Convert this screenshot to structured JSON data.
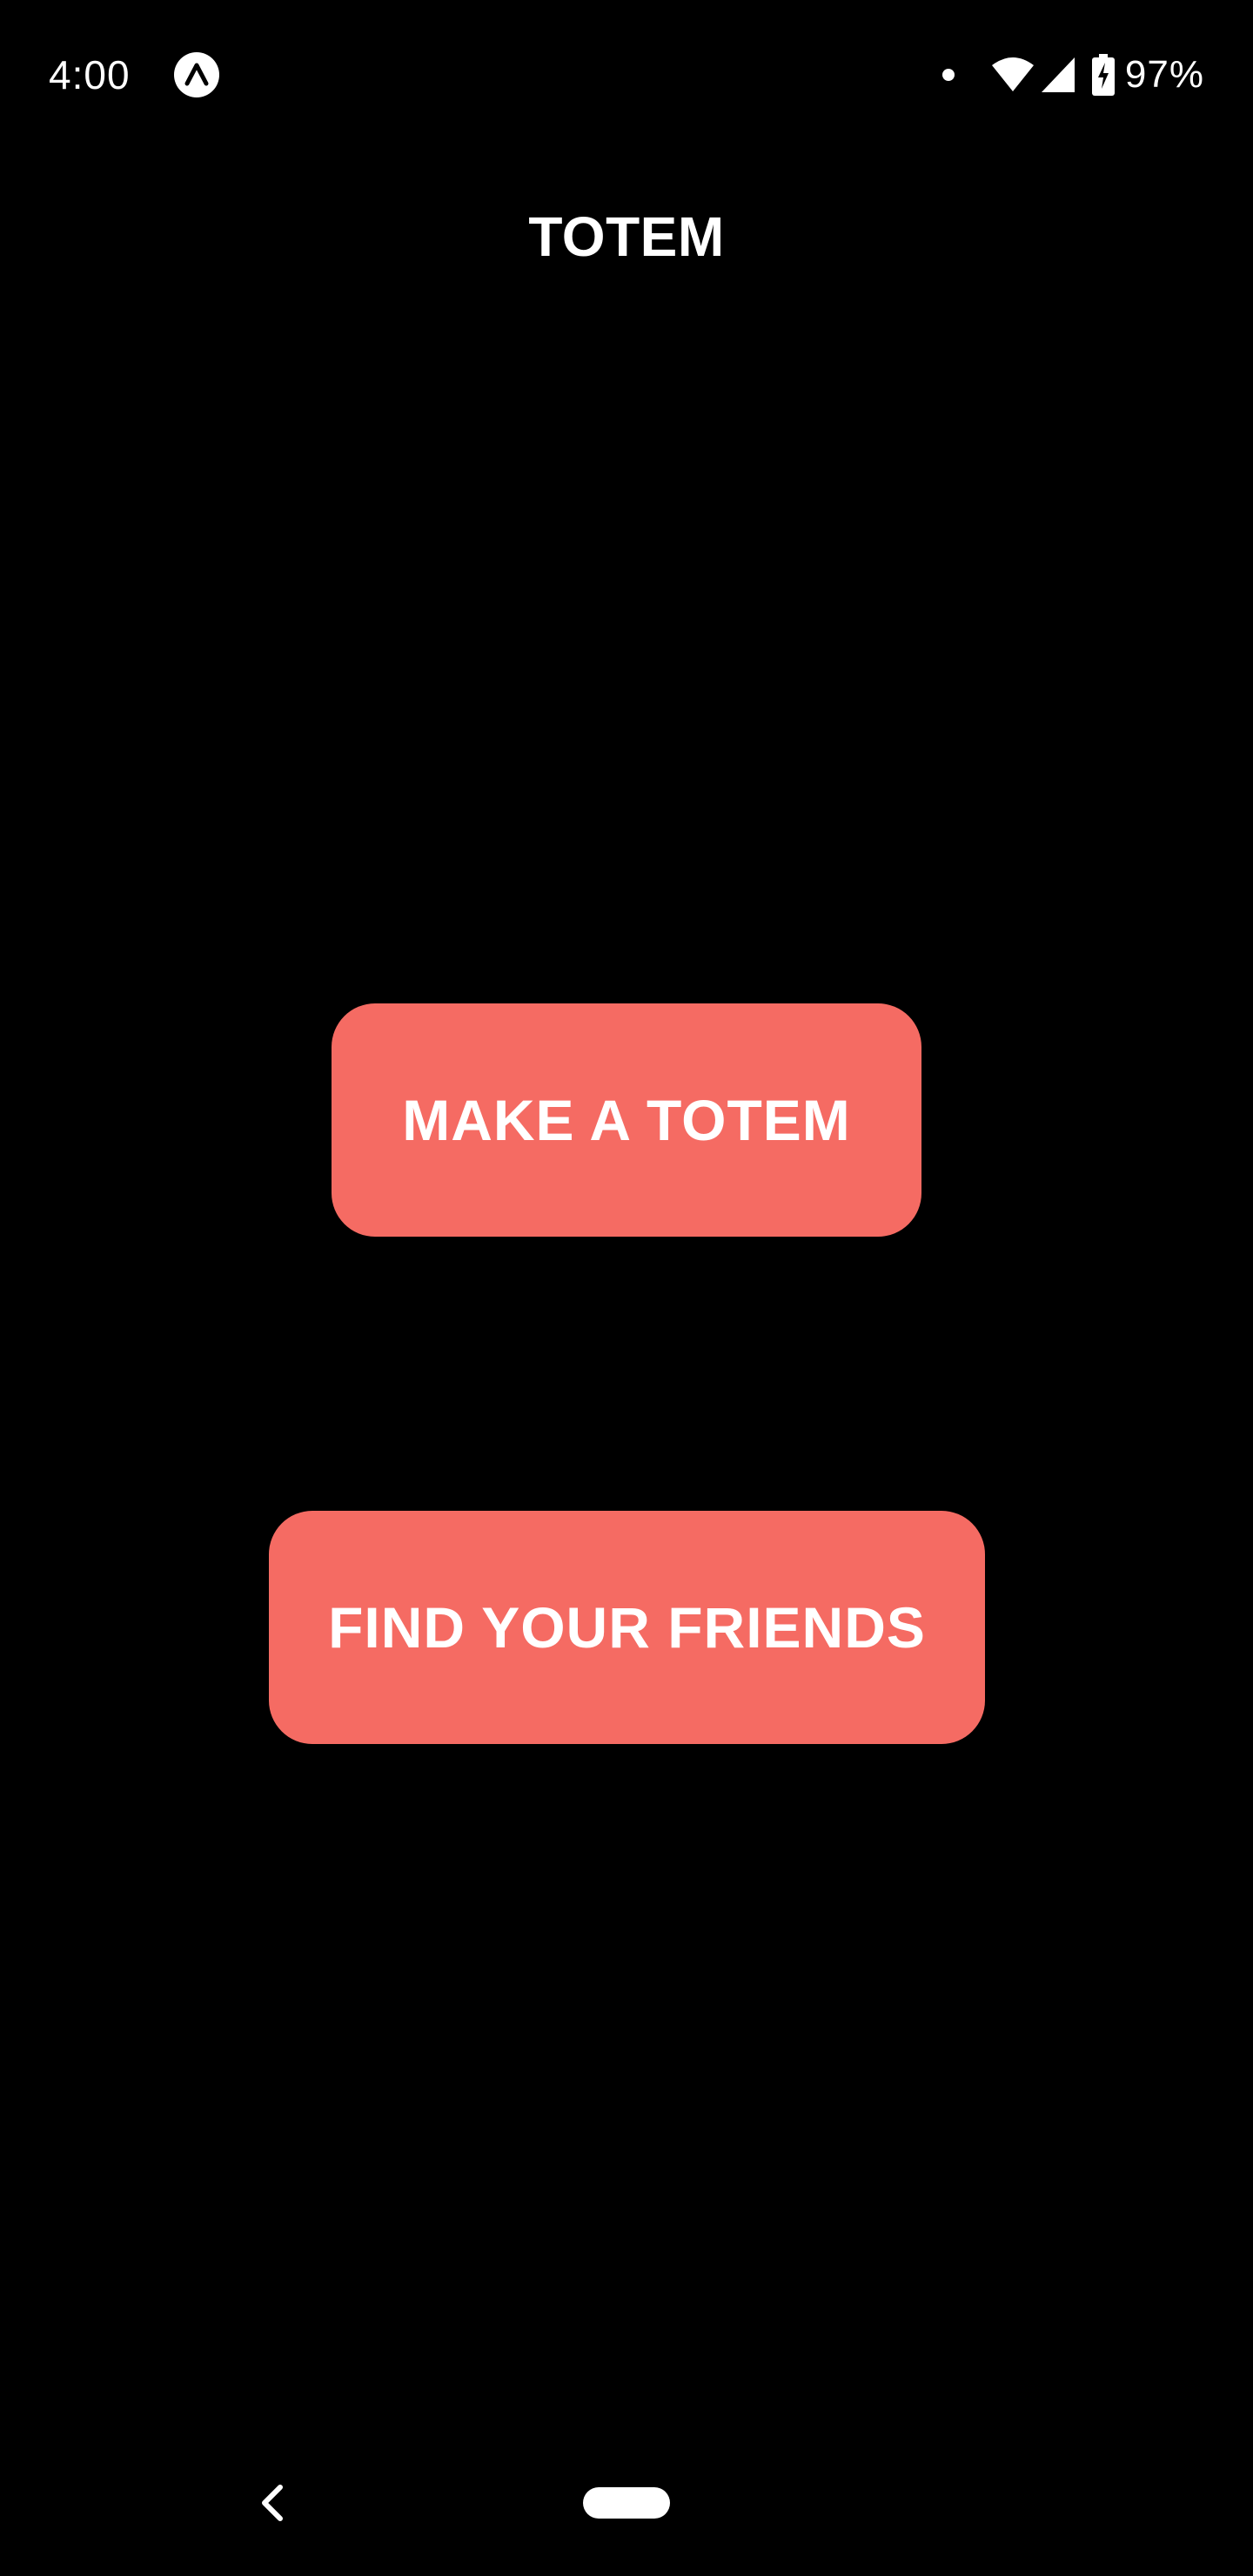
{
  "status_bar": {
    "time": "4:00",
    "app_icon": "expo-icon",
    "notification_icon": "dot-icon",
    "wifi_icon": "wifi-icon",
    "signal_icon": "cell-signal-icon",
    "battery_icon": "battery-charging-icon",
    "battery_percent": "97%"
  },
  "header": {
    "title": "TOTEM"
  },
  "actions": {
    "make_totem_label": "MAKE A TOTEM",
    "find_friends_label": "FIND YOUR FRIENDS"
  },
  "nav_bar": {
    "back_icon": "back-chevron-icon",
    "home_icon": "home-pill-icon"
  },
  "colors": {
    "background": "#000000",
    "button": "#f56b63",
    "text": "#ffffff"
  }
}
